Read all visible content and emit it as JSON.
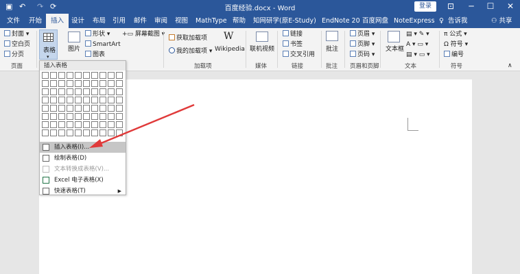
{
  "titlebar": {
    "title": "百度经验.docx - Word",
    "login": "登录",
    "qa": {
      "save": "▣",
      "undo": "↶",
      "redo": "↷",
      "refresh": "⟳"
    },
    "win": {
      "ribbon_opts": "⊡",
      "min": "─",
      "max": "☐",
      "close": "✕"
    }
  },
  "tabs": [
    "文件",
    "开始",
    "插入",
    "设计",
    "布局",
    "引用",
    "邮件",
    "审阅",
    "视图",
    "MathType",
    "帮助",
    "知网研学(原E-Study)",
    "EndNote 20",
    "百度网盘",
    "NoteExpress"
  ],
  "tab_extra": {
    "tell": "告诉我",
    "share": "共享"
  },
  "ribbon": {
    "pages": {
      "cover": "封面",
      "blank": "空白页",
      "break": "分页",
      "label": "页面"
    },
    "table": {
      "label": "表格"
    },
    "illust": {
      "picture": "图片",
      "shapes": "形状",
      "smartart": "SmartArt",
      "chart": "图表",
      "screenshot": "屏幕截图"
    },
    "addins": {
      "get": "获取加载项",
      "my": "我的加载项",
      "wiki": "Wikipedia",
      "label": "加载项"
    },
    "media": {
      "video": "联机视频",
      "label": "媒体"
    },
    "links": {
      "link": "链接",
      "bookmark": "书签",
      "crossref": "交叉引用",
      "label": "链接"
    },
    "comments": {
      "comment": "批注",
      "label": "批注"
    },
    "hf": {
      "header": "页眉",
      "footer": "页脚",
      "pagenum": "页码",
      "label": "页眉和页脚"
    },
    "text": {
      "textbox": "文本框",
      "label": "文本"
    },
    "symbols": {
      "formula": "公式",
      "symbol": "符号",
      "number": "编号",
      "label": "符号"
    }
  },
  "dropdown": {
    "header": "插入表格",
    "items": [
      {
        "label": "插入表格(I)...",
        "state": "highlighted"
      },
      {
        "label": "绘制表格(D)",
        "state": "normal"
      },
      {
        "label": "文本转换成表格(V)...",
        "state": "disabled"
      },
      {
        "label": "Excel 电子表格(X)",
        "state": "normal"
      },
      {
        "label": "快速表格(T)",
        "state": "normal",
        "submenu": true
      }
    ]
  },
  "colors": {
    "brand": "#2b579a",
    "annotation_arrow": "#e03a3a"
  }
}
